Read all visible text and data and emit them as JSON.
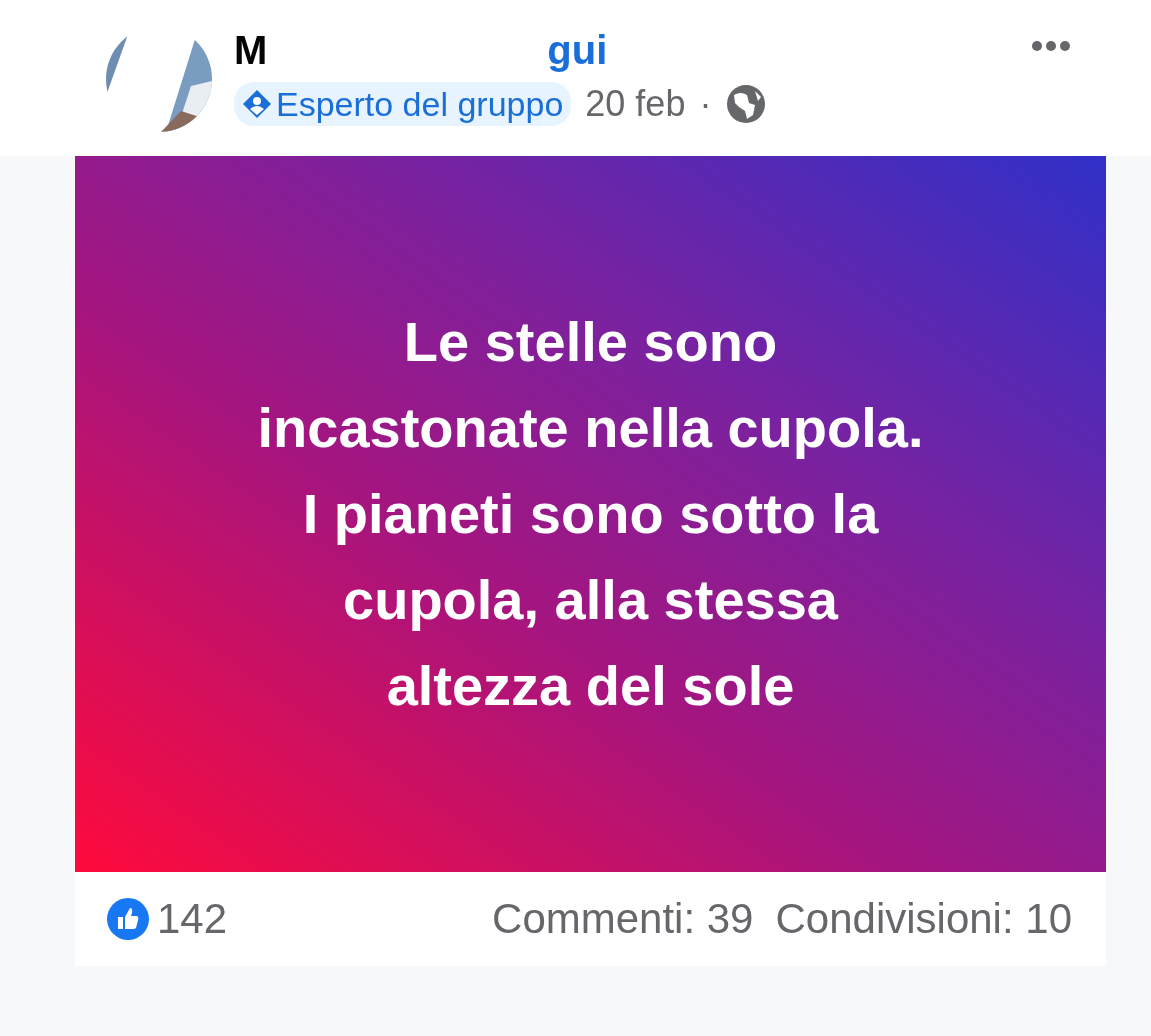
{
  "post": {
    "author_name_start": "M",
    "author_name_end": "gui",
    "badge": "Esperto del gruppo",
    "date": "20 feb",
    "separator": "·",
    "text": "Le stelle sono\nincastonate nella cupola.\nI pianeti sono sotto la\ncupola, alla stessa\naltezza del sole",
    "likes": "142",
    "comments": "Commenti: 39",
    "shares": "Condivisioni: 10"
  }
}
